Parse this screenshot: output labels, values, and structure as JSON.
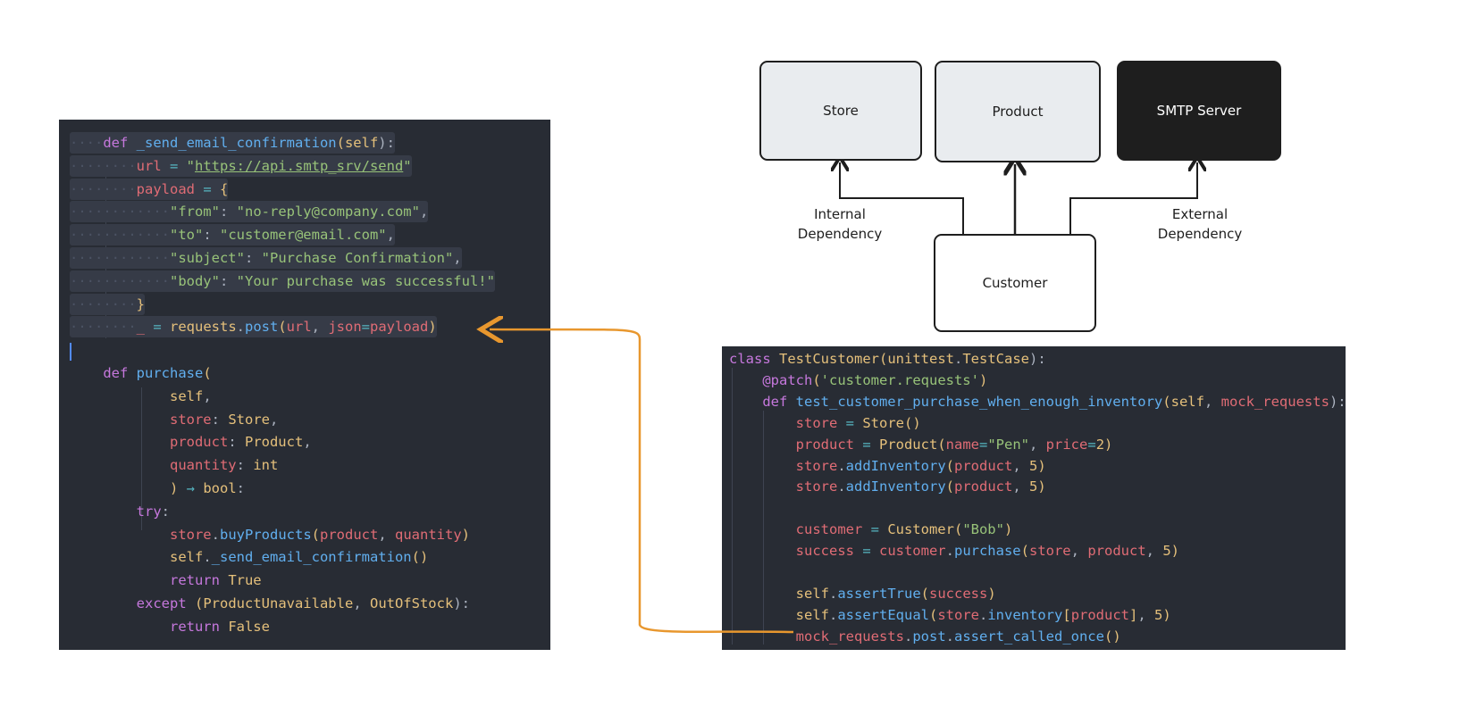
{
  "diagram": {
    "nodes": {
      "store": "Store",
      "product": "Product",
      "smtp": "SMTP Server",
      "customer": "Customer"
    },
    "labels": {
      "internal": "Internal\nDependency",
      "external": "External\nDependency"
    },
    "colors": {
      "node_fill": "#e9ecef",
      "external_fill": "#1e1e1e",
      "connector": "#e8972e"
    }
  },
  "left_code": [
    {
      "indent": "····",
      "tokens": [
        [
          "def ",
          "kw"
        ],
        [
          "_send_email_confirmation",
          "fn"
        ],
        [
          "(",
          "cls"
        ],
        [
          "self",
          "cls"
        ],
        [
          "):",
          "pl"
        ]
      ],
      "sel": true
    },
    {
      "indent": "········",
      "tokens": [
        [
          "url",
          "var"
        ],
        [
          " = ",
          "op"
        ],
        [
          "\"",
          "str"
        ],
        [
          "https://api.smtp_srv/send",
          "url"
        ],
        [
          "\"",
          "str"
        ]
      ],
      "sel": true
    },
    {
      "indent": "········",
      "tokens": [
        [
          "payload",
          "var"
        ],
        [
          " = ",
          "op"
        ],
        [
          "{",
          "cls"
        ]
      ],
      "sel": true
    },
    {
      "indent": "············",
      "tokens": [
        [
          "\"from\"",
          "str"
        ],
        [
          ": ",
          "pl"
        ],
        [
          "\"no-reply@company.com\"",
          "str"
        ],
        [
          ",",
          "pl"
        ]
      ],
      "sel": true
    },
    {
      "indent": "············",
      "tokens": [
        [
          "\"to\"",
          "str"
        ],
        [
          ": ",
          "pl"
        ],
        [
          "\"customer@email.com\"",
          "str"
        ],
        [
          ",",
          "pl"
        ]
      ],
      "sel": true
    },
    {
      "indent": "············",
      "tokens": [
        [
          "\"subject\"",
          "str"
        ],
        [
          ": ",
          "pl"
        ],
        [
          "\"Purchase Confirmation\"",
          "str"
        ],
        [
          ",",
          "pl"
        ]
      ],
      "sel": true
    },
    {
      "indent": "············",
      "tokens": [
        [
          "\"body\"",
          "str"
        ],
        [
          ": ",
          "pl"
        ],
        [
          "\"Your purchase was successful!\"",
          "str"
        ]
      ],
      "sel": true
    },
    {
      "indent": "········",
      "tokens": [
        [
          "}",
          "cls"
        ]
      ],
      "sel": true
    },
    {
      "indent": "········",
      "tokens": [
        [
          "_",
          "var"
        ],
        [
          " = ",
          "op"
        ],
        [
          "requests",
          "cls"
        ],
        [
          ".",
          "pl"
        ],
        [
          "post",
          "fn"
        ],
        [
          "(",
          "cls"
        ],
        [
          "url",
          "var"
        ],
        [
          ", ",
          "pl"
        ],
        [
          "json",
          "var"
        ],
        [
          "=",
          "op"
        ],
        [
          "payload",
          "var"
        ],
        [
          ")",
          "cls"
        ]
      ],
      "sel": true
    },
    {
      "indent": "",
      "tokens": []
    },
    {
      "indent": "    ",
      "tokens": [
        [
          "def ",
          "kw"
        ],
        [
          "purchase",
          "fn"
        ],
        [
          "(",
          "cls"
        ]
      ]
    },
    {
      "indent": "            ",
      "tokens": [
        [
          "self",
          "cls"
        ],
        [
          ",",
          "pl"
        ]
      ]
    },
    {
      "indent": "            ",
      "tokens": [
        [
          "store",
          "var"
        ],
        [
          ": ",
          "pl"
        ],
        [
          "Store",
          "cls"
        ],
        [
          ",",
          "pl"
        ]
      ]
    },
    {
      "indent": "            ",
      "tokens": [
        [
          "product",
          "var"
        ],
        [
          ": ",
          "pl"
        ],
        [
          "Product",
          "cls"
        ],
        [
          ",",
          "pl"
        ]
      ]
    },
    {
      "indent": "            ",
      "tokens": [
        [
          "quantity",
          "var"
        ],
        [
          ": ",
          "pl"
        ],
        [
          "int",
          "cls"
        ]
      ]
    },
    {
      "indent": "            ",
      "tokens": [
        [
          ")",
          "cls"
        ],
        [
          " → ",
          "op"
        ],
        [
          "bool",
          "cls"
        ],
        [
          ":",
          "pl"
        ]
      ]
    },
    {
      "indent": "        ",
      "tokens": [
        [
          "try",
          "kw"
        ],
        [
          ":",
          "pl"
        ]
      ]
    },
    {
      "indent": "            ",
      "tokens": [
        [
          "store",
          "var"
        ],
        [
          ".",
          "pl"
        ],
        [
          "buyProducts",
          "fn"
        ],
        [
          "(",
          "cls"
        ],
        [
          "product",
          "var"
        ],
        [
          ", ",
          "pl"
        ],
        [
          "quantity",
          "var"
        ],
        [
          ")",
          "cls"
        ]
      ]
    },
    {
      "indent": "            ",
      "tokens": [
        [
          "self",
          "cls"
        ],
        [
          ".",
          "pl"
        ],
        [
          "_send_email_confirmation",
          "fn"
        ],
        [
          "()",
          "cls"
        ]
      ]
    },
    {
      "indent": "            ",
      "tokens": [
        [
          "return ",
          "kw"
        ],
        [
          "True",
          "cls"
        ]
      ]
    },
    {
      "indent": "        ",
      "tokens": [
        [
          "except ",
          "kw"
        ],
        [
          "(",
          "cls"
        ],
        [
          "ProductUnavailable",
          "cls"
        ],
        [
          ", ",
          "pl"
        ],
        [
          "OutOfStock",
          "cls"
        ],
        [
          "):",
          "pl"
        ]
      ]
    },
    {
      "indent": "            ",
      "tokens": [
        [
          "return ",
          "kw"
        ],
        [
          "False",
          "cls"
        ]
      ]
    }
  ],
  "right_code": [
    {
      "indent": "",
      "tokens": [
        [
          "class ",
          "kw"
        ],
        [
          "TestCustomer",
          "cls"
        ],
        [
          "(",
          "cls"
        ],
        [
          "unittest",
          "cls"
        ],
        [
          ".",
          "pl"
        ],
        [
          "TestCase",
          "cls"
        ],
        [
          "):",
          "pl"
        ]
      ]
    },
    {
      "indent": "    ",
      "tokens": [
        [
          "@patch",
          "kw"
        ],
        [
          "(",
          "cls"
        ],
        [
          "'customer.requests'",
          "str"
        ],
        [
          ")",
          "cls"
        ]
      ]
    },
    {
      "indent": "    ",
      "tokens": [
        [
          "def ",
          "kw"
        ],
        [
          "test_customer_purchase_when_enough_inventory",
          "fn"
        ],
        [
          "(",
          "cls"
        ],
        [
          "self",
          "cls"
        ],
        [
          ", ",
          "pl"
        ],
        [
          "mock_requests",
          "var"
        ],
        [
          "):",
          "pl"
        ]
      ]
    },
    {
      "indent": "        ",
      "tokens": [
        [
          "store",
          "var"
        ],
        [
          " = ",
          "op"
        ],
        [
          "Store",
          "cls"
        ],
        [
          "()",
          "cls"
        ]
      ]
    },
    {
      "indent": "        ",
      "tokens": [
        [
          "product",
          "var"
        ],
        [
          " = ",
          "op"
        ],
        [
          "Product",
          "cls"
        ],
        [
          "(",
          "cls"
        ],
        [
          "name",
          "var"
        ],
        [
          "=",
          "op"
        ],
        [
          "\"Pen\"",
          "str"
        ],
        [
          ", ",
          "pl"
        ],
        [
          "price",
          "var"
        ],
        [
          "=",
          "op"
        ],
        [
          "2",
          "cls"
        ],
        [
          ")",
          "cls"
        ]
      ]
    },
    {
      "indent": "        ",
      "tokens": [
        [
          "store",
          "var"
        ],
        [
          ".",
          "pl"
        ],
        [
          "addInventory",
          "fn"
        ],
        [
          "(",
          "cls"
        ],
        [
          "product",
          "var"
        ],
        [
          ", ",
          "pl"
        ],
        [
          "5",
          "cls"
        ],
        [
          ")",
          "cls"
        ]
      ]
    },
    {
      "indent": "        ",
      "tokens": [
        [
          "store",
          "var"
        ],
        [
          ".",
          "pl"
        ],
        [
          "addInventory",
          "fn"
        ],
        [
          "(",
          "cls"
        ],
        [
          "product",
          "var"
        ],
        [
          ", ",
          "pl"
        ],
        [
          "5",
          "cls"
        ],
        [
          ")",
          "cls"
        ]
      ]
    },
    {
      "indent": "",
      "tokens": []
    },
    {
      "indent": "        ",
      "tokens": [
        [
          "customer",
          "var"
        ],
        [
          " = ",
          "op"
        ],
        [
          "Customer",
          "cls"
        ],
        [
          "(",
          "cls"
        ],
        [
          "\"Bob\"",
          "str"
        ],
        [
          ")",
          "cls"
        ]
      ]
    },
    {
      "indent": "        ",
      "tokens": [
        [
          "success",
          "var"
        ],
        [
          " = ",
          "op"
        ],
        [
          "customer",
          "var"
        ],
        [
          ".",
          "pl"
        ],
        [
          "purchase",
          "fn"
        ],
        [
          "(",
          "cls"
        ],
        [
          "store",
          "var"
        ],
        [
          ", ",
          "pl"
        ],
        [
          "product",
          "var"
        ],
        [
          ", ",
          "pl"
        ],
        [
          "5",
          "cls"
        ],
        [
          ")",
          "cls"
        ]
      ]
    },
    {
      "indent": "",
      "tokens": []
    },
    {
      "indent": "        ",
      "tokens": [
        [
          "self",
          "cls"
        ],
        [
          ".",
          "pl"
        ],
        [
          "assertTrue",
          "fn"
        ],
        [
          "(",
          "cls"
        ],
        [
          "success",
          "var"
        ],
        [
          ")",
          "cls"
        ]
      ]
    },
    {
      "indent": "        ",
      "tokens": [
        [
          "self",
          "cls"
        ],
        [
          ".",
          "pl"
        ],
        [
          "assertEqual",
          "fn"
        ],
        [
          "(",
          "cls"
        ],
        [
          "store",
          "var"
        ],
        [
          ".",
          "pl"
        ],
        [
          "inventory",
          "fn"
        ],
        [
          "[",
          "cls"
        ],
        [
          "product",
          "var"
        ],
        [
          "]",
          "cls"
        ],
        [
          ", ",
          "pl"
        ],
        [
          "5",
          "cls"
        ],
        [
          ")",
          "cls"
        ]
      ]
    },
    {
      "indent": "        ",
      "tokens": [
        [
          "mock_requests",
          "var"
        ],
        [
          ".",
          "pl"
        ],
        [
          "post",
          "fn"
        ],
        [
          ".",
          "pl"
        ],
        [
          "assert_called_once",
          "fn"
        ],
        [
          "()",
          "cls"
        ]
      ]
    }
  ]
}
